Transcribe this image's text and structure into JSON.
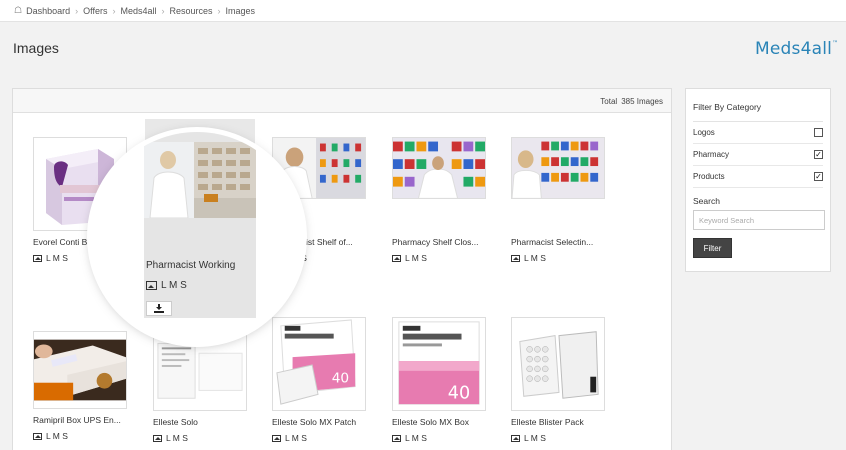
{
  "breadcrumb": {
    "home_icon": "home-icon",
    "items": [
      "Dashboard",
      "Offers",
      "Meds4all",
      "Resources",
      "Images"
    ]
  },
  "page": {
    "title": "Images"
  },
  "brand": {
    "logo_text": "Meds4all",
    "tm": "™",
    "color": "#2a84b7"
  },
  "panel": {
    "total_label": "Total",
    "total_value": "385 Images"
  },
  "sizes_label": "L M S",
  "grid": {
    "row1": [
      {
        "caption": "Evorel Conti Box"
      },
      {
        "caption": "Pharmacist Working"
      },
      {
        "caption": "Pharmacist Shelf of..."
      },
      {
        "caption": "Pharmacy Shelf Clos..."
      },
      {
        "caption": "Pharmacist Selectin..."
      }
    ],
    "row2": [
      {
        "caption": "Ramipril Box UPS En..."
      },
      {
        "caption": "Elleste Solo"
      },
      {
        "caption": "Elleste Solo MX Patch"
      },
      {
        "caption": "Elleste Solo MX Box"
      },
      {
        "caption": "Elleste Blister Pack"
      }
    ]
  },
  "magnifier": {
    "caption": "Pharmacist Working",
    "sizes": "L M S",
    "download_icon": "download-icon"
  },
  "filter": {
    "title": "Filter By Category",
    "categories": [
      {
        "label": "Logos",
        "checked": false,
        "mark": ""
      },
      {
        "label": "Pharmacy",
        "checked": true,
        "mark": "✓"
      },
      {
        "label": "Products",
        "checked": true,
        "mark": "✓"
      }
    ],
    "search_label": "Search",
    "search_placeholder": "Keyword Search",
    "search_value": "",
    "button_label": "Filter"
  }
}
